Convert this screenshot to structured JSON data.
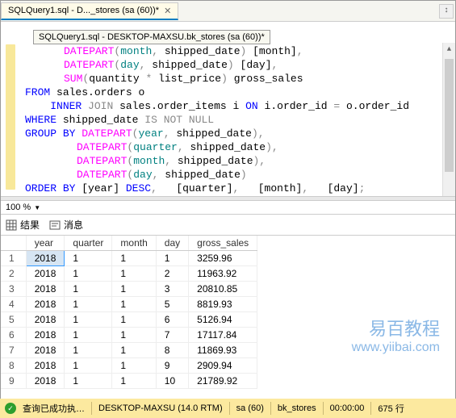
{
  "tab": {
    "title": "SQLQuery1.sql - D..._stores (sa (60))*"
  },
  "tooltip": "SQLQuery1.sql - DESKTOP-MAXSU.bk_stores (sa (60))*",
  "code": {
    "l1a": "DATEPART",
    "l1b": "month",
    "l1c": "shipped_date",
    "l1d": "[month]",
    "l2a": "DATEPART",
    "l2b": "day",
    "l2c": "shipped_date",
    "l2d": "[day]",
    "l3a": "SUM",
    "l3b": "quantity",
    "l3c": "list_price",
    "l3d": "gross_sales",
    "l4a": "FROM",
    "l4b": "sales.orders o",
    "l5a": "INNER",
    "l5b": "JOIN",
    "l5c": "sales.order_items i",
    "l5d": "ON",
    "l5e": "i.order_id",
    "l5f": "o.order_id",
    "l6a": "WHERE",
    "l6b": "shipped_date",
    "l6c": "IS",
    "l6d": "NOT",
    "l6e": "NULL",
    "l7a": "GROUP",
    "l7b": "BY",
    "l7c": "DATEPART",
    "l7d": "year",
    "l7e": "shipped_date",
    "l8a": "DATEPART",
    "l8b": "quarter",
    "l8c": "shipped_date",
    "l9a": "DATEPART",
    "l9b": "month",
    "l9c": "shipped_date",
    "l10a": "DATEPART",
    "l10b": "day",
    "l10c": "shipped_date",
    "l11a": "ORDER",
    "l11b": "BY",
    "l11c": "[year]",
    "l11d": "DESC",
    "l11e": "[quarter]",
    "l11f": "[month]",
    "l11g": "[day]"
  },
  "zoom": "100 %",
  "resultsTabs": {
    "results": "结果",
    "messages": "消息"
  },
  "columns": [
    "",
    "year",
    "quarter",
    "month",
    "day",
    "gross_sales"
  ],
  "rows": [
    [
      "1",
      "2018",
      "1",
      "1",
      "1",
      "3259.96"
    ],
    [
      "2",
      "2018",
      "1",
      "1",
      "2",
      "11963.92"
    ],
    [
      "3",
      "2018",
      "1",
      "1",
      "3",
      "20810.85"
    ],
    [
      "4",
      "2018",
      "1",
      "1",
      "5",
      "8819.93"
    ],
    [
      "5",
      "2018",
      "1",
      "1",
      "6",
      "5126.94"
    ],
    [
      "6",
      "2018",
      "1",
      "1",
      "7",
      "17117.84"
    ],
    [
      "7",
      "2018",
      "1",
      "1",
      "8",
      "11869.93"
    ],
    [
      "8",
      "2018",
      "1",
      "1",
      "9",
      "2909.94"
    ],
    [
      "9",
      "2018",
      "1",
      "1",
      "10",
      "21789.92"
    ]
  ],
  "status": {
    "ok": "查询已成功执…",
    "server": "DESKTOP-MAXSU (14.0 RTM)",
    "user": "sa (60)",
    "db": "bk_stores",
    "time": "00:00:00",
    "rows": "675 行"
  },
  "watermark": {
    "l1": "易百教程",
    "l2": "www.yiibai.com"
  }
}
